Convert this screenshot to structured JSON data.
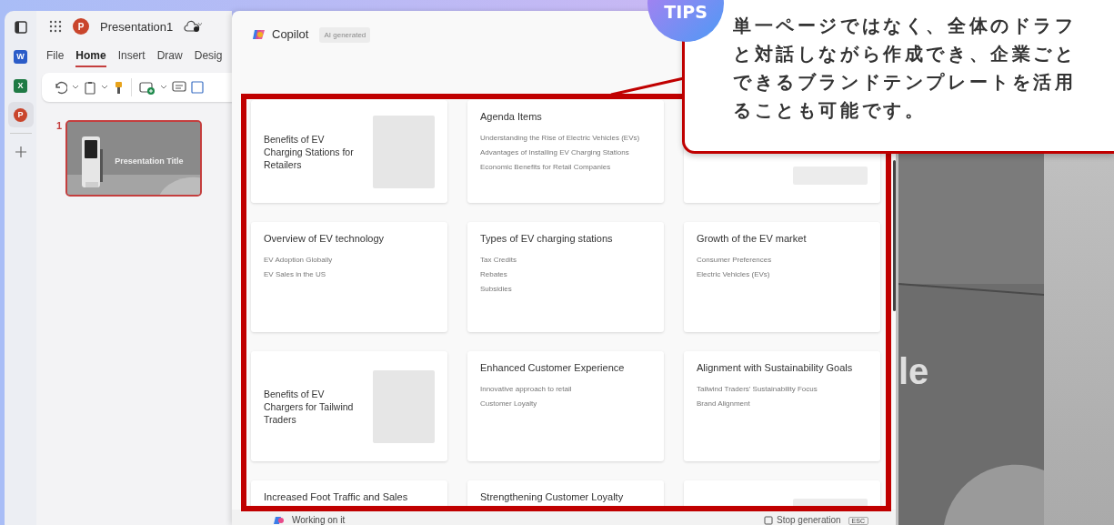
{
  "rail": {
    "items": [
      {
        "kind": "panel",
        "selected": false
      },
      {
        "kind": "app",
        "label": "W",
        "color": "#2b5cc8",
        "selected": false
      },
      {
        "kind": "app",
        "label": "X",
        "color": "#1f7a45",
        "selected": false
      },
      {
        "kind": "app",
        "label": "P",
        "color": "#c9452c",
        "selected": true
      },
      {
        "kind": "add",
        "selected": false
      }
    ]
  },
  "ppt": {
    "logo": "P",
    "title": "Presentation1",
    "tabs": [
      {
        "label": "File",
        "selected": false
      },
      {
        "label": "Home",
        "selected": true
      },
      {
        "label": "Insert",
        "selected": false
      },
      {
        "label": "Draw",
        "selected": false
      },
      {
        "label": "Desig",
        "selected": false
      }
    ],
    "toolbar": [
      {
        "kind": "undo"
      },
      {
        "kind": "chevron"
      },
      {
        "kind": "clipboard"
      },
      {
        "kind": "chevron"
      },
      {
        "kind": "brush"
      },
      {
        "kind": "divider"
      },
      {
        "kind": "new-slide"
      },
      {
        "kind": "chevron"
      },
      {
        "kind": "comment"
      },
      {
        "kind": "layout"
      }
    ],
    "slides": [
      {
        "number": "1",
        "title": "Presentation Title",
        "selected": true
      }
    ]
  },
  "copilot": {
    "title": "Copilot",
    "badge": "AI generated",
    "cards": [
      {
        "kind": "title",
        "title": "Benefits of EV Charging Stations for Retailers"
      },
      {
        "kind": "bullets",
        "title": "Agenda Items",
        "items": [
          "Understanding the Rise of Electric Vehicles (EVs)",
          "Advantages of Installing EV Charging Stations",
          "Economic Benefits for Retail Companies"
        ]
      },
      {
        "kind": "blank"
      },
      {
        "kind": "bullets",
        "title": "Overview of EV technology",
        "items": [
          "EV Adoption Globally",
          "EV Sales in the US"
        ]
      },
      {
        "kind": "bullets",
        "title": "Types of EV charging stations",
        "items": [
          "Tax Credits",
          "Rebates",
          "Subsidies"
        ]
      },
      {
        "kind": "bullets",
        "title": "Growth of the EV market",
        "items": [
          "Consumer Preferences",
          "Electric Vehicles (EVs)"
        ]
      },
      {
        "kind": "title",
        "title": "Benefits of EV Chargers for Tailwind Traders"
      },
      {
        "kind": "bullets",
        "title": "Enhanced Customer Experience",
        "items": [
          "Innovative approach to retail",
          "Customer Loyalty"
        ]
      },
      {
        "kind": "bullets",
        "title": "Alignment with Sustainability Goals",
        "items": [
          "Tailwind Traders' Sustainability Focus",
          "Brand Alignment"
        ]
      },
      {
        "kind": "bullets",
        "title": "Increased Foot Traffic and Sales"
      },
      {
        "kind": "bullets",
        "title": "Strengthening Customer Loyalty"
      },
      {
        "kind": "blank"
      }
    ],
    "status": "Working on it",
    "stop": "Stop generation",
    "shortcut": "ESC"
  },
  "canvas": {
    "text": "le"
  },
  "tip": {
    "badge": "TIPS",
    "lines": [
      "単一ページではなく、全体のドラフ",
      "と対話しながら作成でき、企業ごと",
      "できるブランドテンプレートを活用",
      "ることも可能です。"
    ]
  }
}
